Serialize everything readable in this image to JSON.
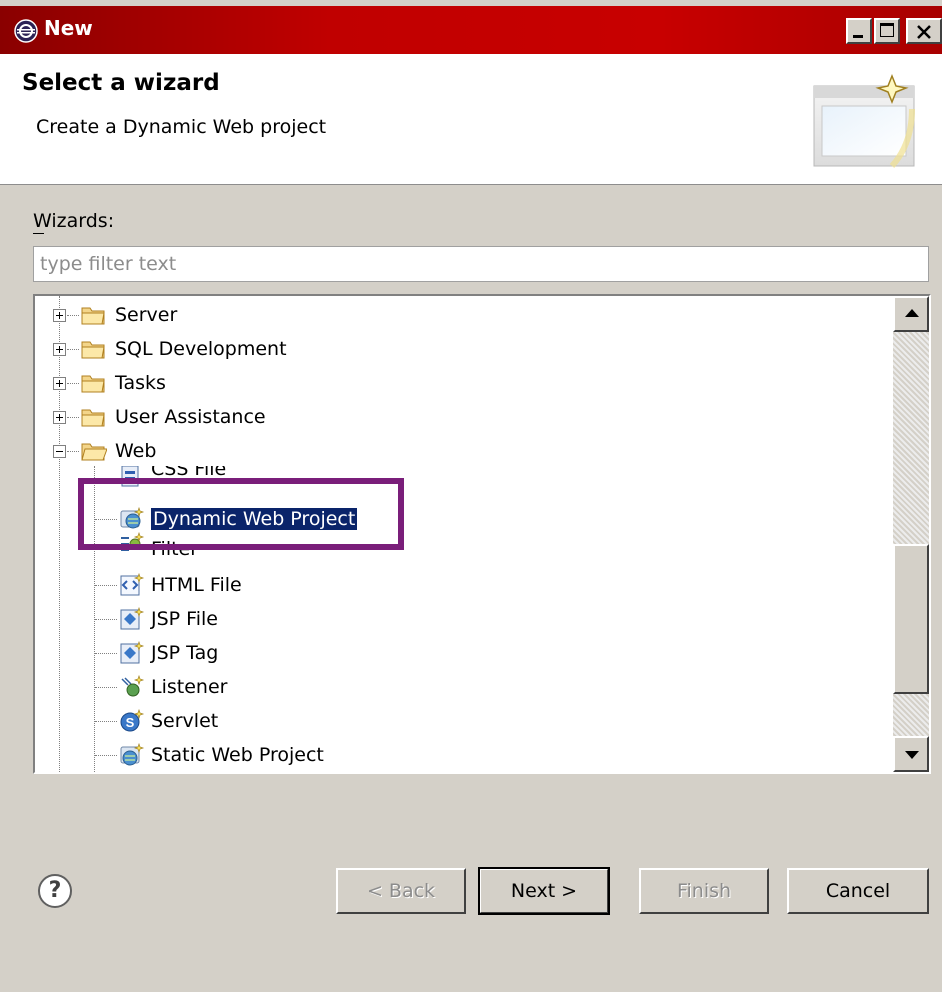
{
  "window": {
    "title": "New"
  },
  "header": {
    "title": "Select a wizard",
    "subtitle": "Create a Dynamic Web project"
  },
  "wizards_label": "Wizards:",
  "filter": {
    "placeholder": "type filter text"
  },
  "tree": {
    "categories": [
      {
        "label": "Server",
        "expanded": false
      },
      {
        "label": "SQL Development",
        "expanded": false
      },
      {
        "label": "Tasks",
        "expanded": false
      },
      {
        "label": "User Assistance",
        "expanded": false
      },
      {
        "label": "Web",
        "expanded": true
      }
    ],
    "web_items": [
      {
        "label": "CSS File",
        "icon": "css-file-icon"
      },
      {
        "label": "Dynamic Web Project",
        "icon": "dynamic-web-project-icon",
        "selected": true
      },
      {
        "label": "Filter",
        "icon": "filter-icon"
      },
      {
        "label": "HTML File",
        "icon": "html-file-icon"
      },
      {
        "label": "JSP File",
        "icon": "jsp-file-icon"
      },
      {
        "label": "JSP Tag",
        "icon": "jsp-tag-icon"
      },
      {
        "label": "Listener",
        "icon": "listener-icon"
      },
      {
        "label": "Servlet",
        "icon": "servlet-icon"
      },
      {
        "label": "Static Web Project",
        "icon": "static-web-project-icon"
      }
    ]
  },
  "buttons": {
    "help": "?",
    "back": "< Back",
    "next": "Next >",
    "finish": "Finish",
    "cancel": "Cancel"
  },
  "colors": {
    "title_bar": "#c00000",
    "selection": "#0a246a",
    "highlight_box": "#7a1e7a"
  }
}
